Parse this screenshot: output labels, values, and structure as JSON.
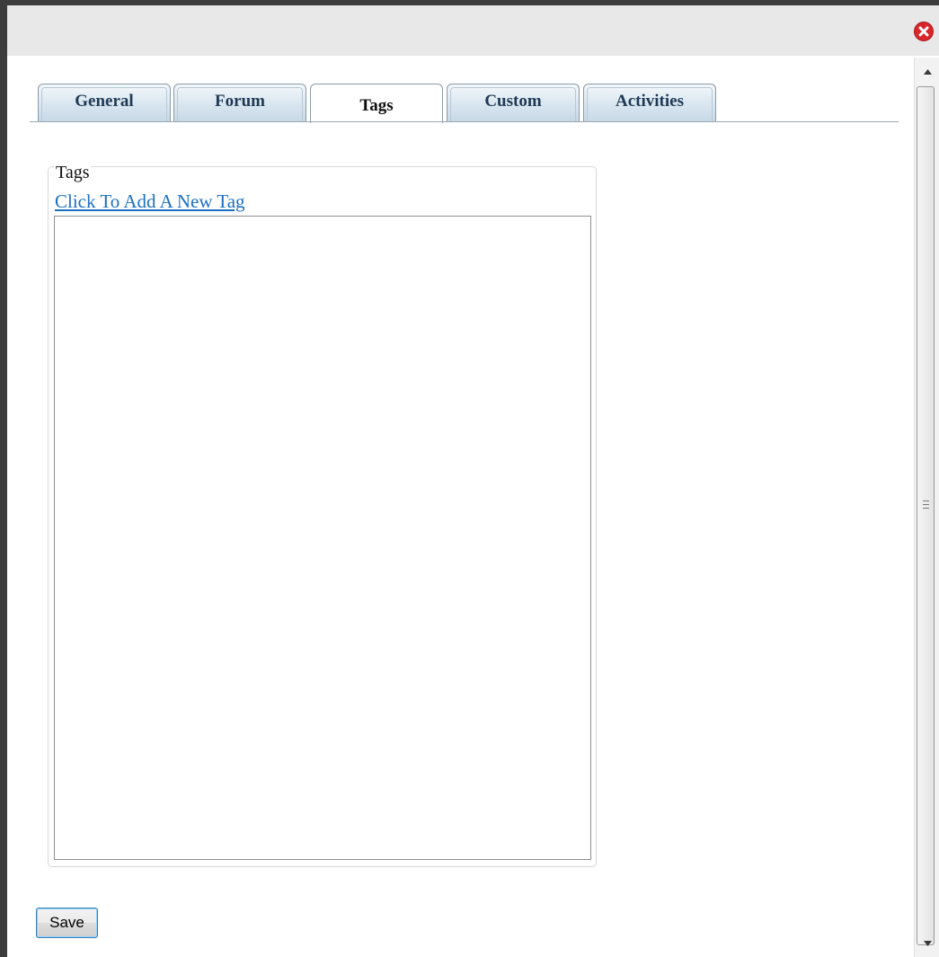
{
  "dialog": {
    "close_icon": "close-icon",
    "accent_close_color": "#d9262a"
  },
  "tabs": [
    {
      "label": "General",
      "active": false
    },
    {
      "label": "Forum",
      "active": false
    },
    {
      "label": "Tags",
      "active": true
    },
    {
      "label": "Custom",
      "active": false
    },
    {
      "label": "Activities",
      "active": false
    }
  ],
  "tags_panel": {
    "legend": "Tags",
    "add_link": "Click To Add A New Tag",
    "link_color": "#1a6fc2"
  },
  "actions": {
    "save_label": "Save"
  },
  "scrollbar": {
    "up_icon": "scroll-up-arrow-icon",
    "down_icon": "scroll-down-arrow-icon"
  }
}
